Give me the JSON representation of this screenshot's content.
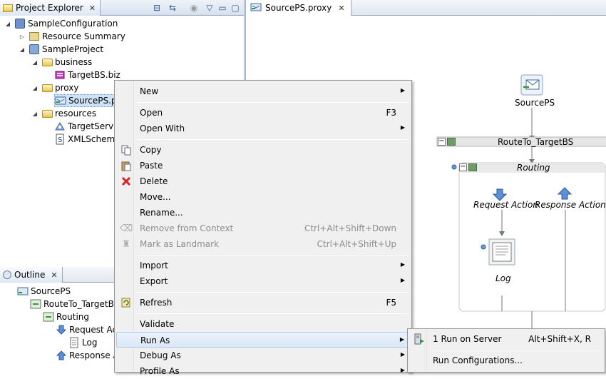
{
  "explorer": {
    "tab_title": "Project Explorer",
    "close": "✕",
    "toolbar": {
      "collapse": "⊟",
      "link": "⇆",
      "focus": "◉",
      "menu": "▽",
      "minimize": "▭",
      "maximize": "▢"
    },
    "tree": [
      {
        "label": "SampleConfiguration",
        "twisty": "◢",
        "icon": "configuration-project-icon"
      },
      {
        "label": "Resource Summary",
        "twisty": "▷",
        "icon": "resource-summary-icon"
      },
      {
        "label": "SampleProject",
        "twisty": "◢",
        "icon": "project-icon"
      },
      {
        "label": "business",
        "twisty": "◢",
        "icon": "folder-icon"
      },
      {
        "label": "TargetBS.biz",
        "twisty": "",
        "icon": "business-service-icon"
      },
      {
        "label": "proxy",
        "twisty": "◢",
        "icon": "folder-icon"
      },
      {
        "label": "SourcePS.p",
        "twisty": "",
        "icon": "proxy-service-icon"
      },
      {
        "label": "resources",
        "twisty": "◢",
        "icon": "folder-icon"
      },
      {
        "label": "TargetServi",
        "twisty": "",
        "icon": "wsdl-icon"
      },
      {
        "label": "XMLSchem",
        "twisty": "",
        "icon": "schema-icon"
      }
    ]
  },
  "outline": {
    "tab_title": "Outline",
    "close": "✕",
    "tree": [
      {
        "label": "SourcePS",
        "icon": "proxy-service-icon"
      },
      {
        "label": "RouteTo_TargetBS",
        "icon": "route-node-icon"
      },
      {
        "label": "Routing",
        "icon": "routing-icon"
      },
      {
        "label": "Request Ac",
        "icon": "request-action-icon"
      },
      {
        "label": "Log",
        "icon": "log-icon"
      },
      {
        "label": "Response A",
        "icon": "response-action-icon"
      }
    ]
  },
  "editor": {
    "tab_title": "SourcePS.proxy",
    "close": "✕",
    "flow": {
      "start": "SourcePS",
      "route_node": "RouteTo_TargetBS",
      "routing": "Routing",
      "request_action": "Request Action",
      "response_action": "Response Action",
      "log": "Log",
      "collapse_glyph": "−"
    }
  },
  "context_menu": {
    "items": [
      {
        "label": "New",
        "accel": "",
        "submenu": true,
        "disabled": false,
        "icon": ""
      },
      {
        "label": "Open",
        "accel": "F3",
        "submenu": false,
        "disabled": false,
        "icon": ""
      },
      {
        "label": "Open With",
        "accel": "",
        "submenu": true,
        "disabled": false,
        "icon": ""
      },
      {
        "label": "Copy",
        "accel": "",
        "submenu": false,
        "disabled": false,
        "icon": "copy-icon"
      },
      {
        "label": "Paste",
        "accel": "",
        "submenu": false,
        "disabled": false,
        "icon": "paste-icon"
      },
      {
        "label": "Delete",
        "accel": "",
        "submenu": false,
        "disabled": false,
        "icon": "delete-icon"
      },
      {
        "label": "Move...",
        "accel": "",
        "submenu": false,
        "disabled": false,
        "icon": ""
      },
      {
        "label": "Rename...",
        "accel": "",
        "submenu": false,
        "disabled": false,
        "icon": ""
      },
      {
        "label": "Remove from Context",
        "accel": "Ctrl+Alt+Shift+Down",
        "submenu": false,
        "disabled": true,
        "icon": "remove-context-icon"
      },
      {
        "label": "Mark as Landmark",
        "accel": "Ctrl+Alt+Shift+Up",
        "submenu": false,
        "disabled": true,
        "icon": "landmark-icon"
      },
      {
        "label": "Import",
        "accel": "",
        "submenu": true,
        "disabled": false,
        "icon": ""
      },
      {
        "label": "Export",
        "accel": "",
        "submenu": true,
        "disabled": false,
        "icon": ""
      },
      {
        "label": "Refresh",
        "accel": "F5",
        "submenu": false,
        "disabled": false,
        "icon": "refresh-icon"
      },
      {
        "label": "Validate",
        "accel": "",
        "submenu": false,
        "disabled": false,
        "icon": ""
      },
      {
        "label": "Run As",
        "accel": "",
        "submenu": true,
        "disabled": false,
        "icon": "",
        "highlighted": true
      },
      {
        "label": "Debug As",
        "accel": "",
        "submenu": true,
        "disabled": false,
        "icon": ""
      },
      {
        "label": "Profile As",
        "accel": "",
        "submenu": true,
        "disabled": false,
        "icon": ""
      }
    ],
    "arrow": "▶"
  },
  "submenu": {
    "items": [
      {
        "label": "1 Run on Server",
        "accel": "Alt+Shift+X, R",
        "icon": "run-on-server-icon"
      },
      {
        "label": "Run Configurations...",
        "accel": "",
        "icon": ""
      }
    ]
  }
}
